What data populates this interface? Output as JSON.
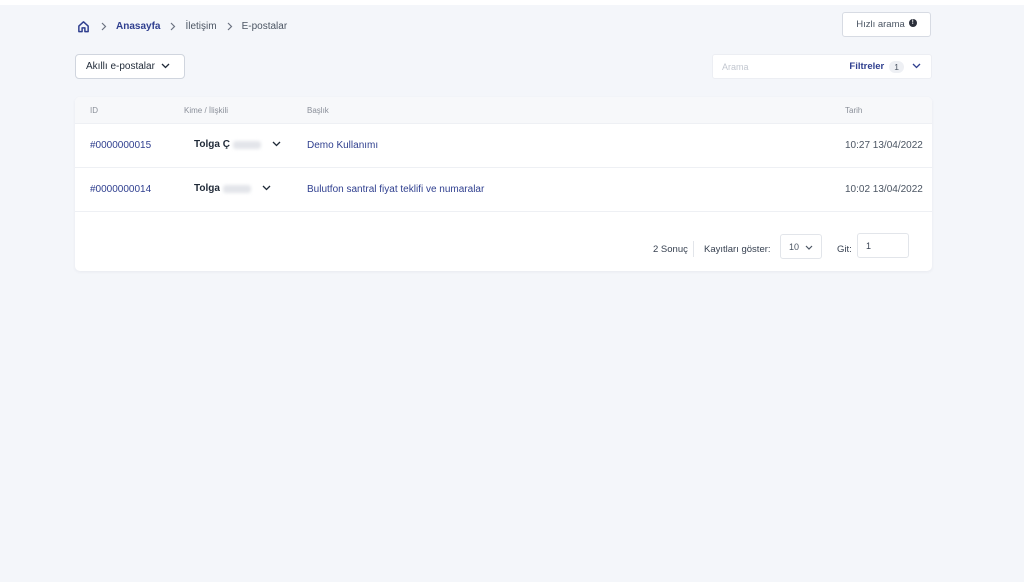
{
  "breadcrumb": {
    "home_icon": "home-icon",
    "items": [
      "Anasayfa",
      "İletişim",
      "E-postalar"
    ]
  },
  "quick_search": {
    "label": "Hızlı arama",
    "icon": "info-icon"
  },
  "filters_bar": {
    "smart_dropdown_label": "Akıllı e-postalar",
    "search_placeholder": "Arama",
    "filters_label": "Filtreler",
    "filters_count": "1"
  },
  "table": {
    "columns": [
      "ID",
      "Kime / İlişkili",
      "Başlık",
      "Tarih"
    ],
    "rows": [
      {
        "id": "#0000000015",
        "contact": "Tolga Ç",
        "title": "Demo Kullanımı",
        "date": "10:27 13/04/2022"
      },
      {
        "id": "#0000000014",
        "contact": "Tolga",
        "title": "Bulutfon santral fiyat teklifi ve numaralar",
        "date": "10:02 13/04/2022"
      }
    ]
  },
  "pagination": {
    "result_count": "2 Sonuç",
    "show_label": "Kayıtları göster:",
    "page_size": "10",
    "go_label": "Git:",
    "go_value": "1"
  },
  "colors": {
    "accent": "#2f3f8f",
    "background": "#f4f6fa"
  }
}
